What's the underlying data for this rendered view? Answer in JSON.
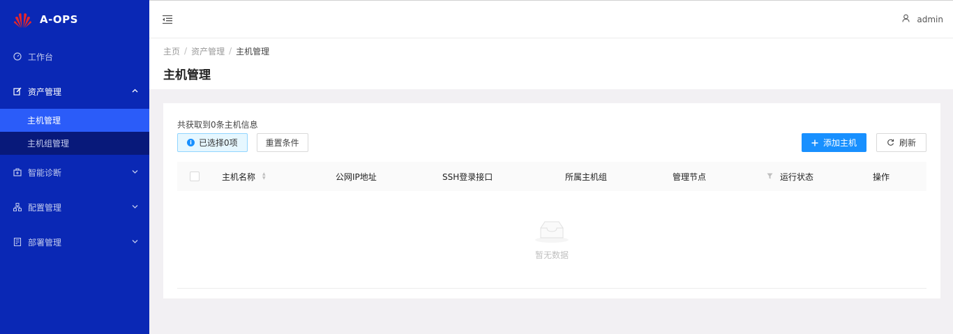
{
  "app": {
    "title": "A-OPS"
  },
  "sidebar": {
    "items": [
      {
        "label": "工作台",
        "icon": "dashboard-icon"
      },
      {
        "label": "资产管理",
        "icon": "edit-icon",
        "open": true,
        "children": [
          {
            "label": "主机管理",
            "active": true
          },
          {
            "label": "主机组管理"
          }
        ]
      },
      {
        "label": "智能诊断",
        "icon": "medical-box-icon"
      },
      {
        "label": "配置管理",
        "icon": "cluster-icon"
      },
      {
        "label": "部署管理",
        "icon": "calculator-icon"
      }
    ]
  },
  "header": {
    "user": "admin"
  },
  "breadcrumb": [
    "主页",
    "资产管理",
    "主机管理"
  ],
  "page": {
    "title": "主机管理"
  },
  "card": {
    "count_text": "共获取到0条主机信息",
    "selected_text": "已选择0项",
    "reset_label": "重置条件",
    "add_label": "添加主机",
    "refresh_label": "刷新"
  },
  "table": {
    "columns": [
      "主机名称",
      "公网IP地址",
      "SSH登录接口",
      "所属主机组",
      "管理节点",
      "运行状态",
      "操作"
    ],
    "empty_text": "暂无数据"
  },
  "colors": {
    "sidebar": "#0a28b5",
    "submenu": "#08197a",
    "active": "#2b5cf9",
    "primary": "#1890ff"
  }
}
